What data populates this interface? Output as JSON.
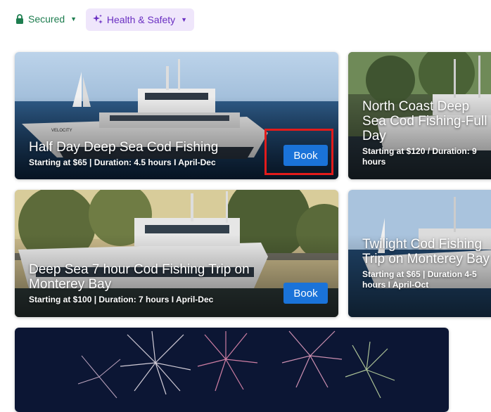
{
  "header": {
    "secured_label": "Secured",
    "health_label": "Health & Safety",
    "lock_icon": "lock-icon",
    "sparkle_icon": "sparkle-icon"
  },
  "colors": {
    "secured_green": "#1e7d4f",
    "pill_bg": "#efe6fb",
    "pill_text": "#6a2fc2",
    "book_blue": "#1a73d9",
    "highlight_red": "#e21b1b"
  },
  "cards": [
    {
      "title": "Half Day Deep Sea Cod Fishing",
      "subtitle": "Starting at $65 | Duration: 4.5 hours I April-Dec",
      "book_label": "Book",
      "boat_name": "VELOCITY"
    },
    {
      "title": "North Coast Deep Sea Cod Fishing-Full Day",
      "subtitle": "Starting at $120 / Duration: 9 hours"
    },
    {
      "title": "Deep Sea 7 hour Cod Fishing Trip on Monterey Bay",
      "subtitle": "Starting at $100 | Duration: 7 hours I April-Dec",
      "book_label": "Book"
    },
    {
      "title": "Twilight Cod Fishing Trip on Monterey Bay",
      "subtitle": "Starting at $65 | Duration 4-5 hours I April-Oct"
    },
    {
      "title": ""
    }
  ]
}
